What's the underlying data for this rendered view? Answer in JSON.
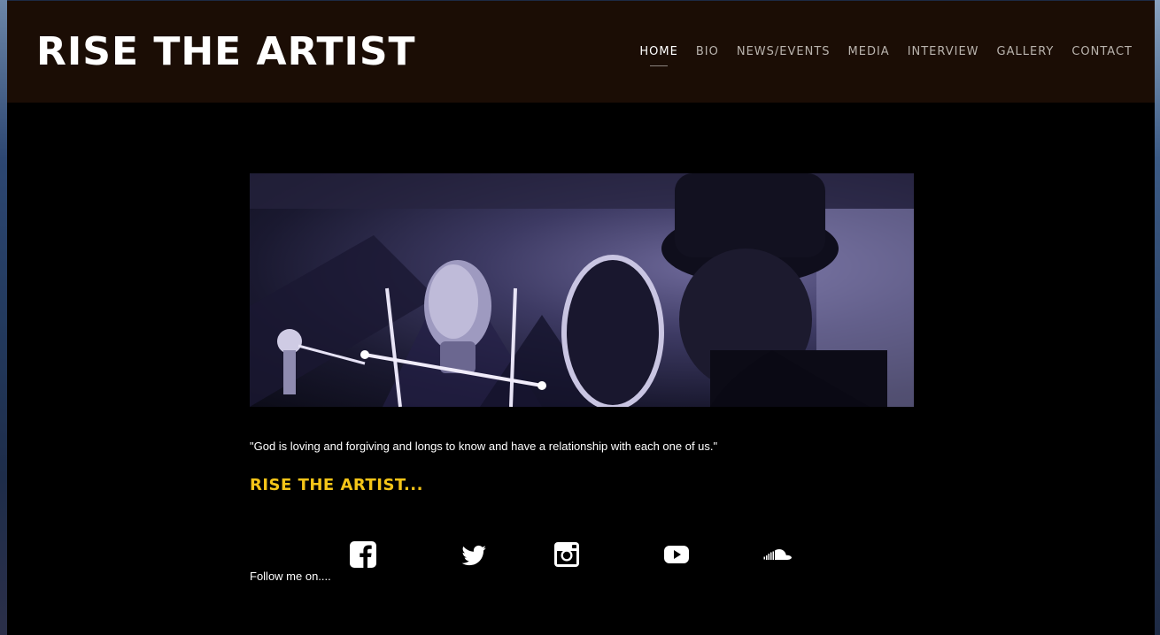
{
  "site": {
    "title": "RISE THE ARTIST",
    "nav": [
      {
        "label": "HOME"
      },
      {
        "label": "BIO"
      },
      {
        "label": "NEWS/EVENTS"
      },
      {
        "label": "MEDIA"
      },
      {
        "label": "INTERVIEW"
      },
      {
        "label": "GALLERY"
      },
      {
        "label": "CONTACT"
      }
    ],
    "active_nav": "HOME"
  },
  "main": {
    "quote": "\"God is loving and forgiving and longs to know and have a relationship with each one of us.\"",
    "tagline": "RISE THE ARTIST...",
    "follow_label": "Follow me on....",
    "social": [
      {
        "icon": "facebook-icon"
      },
      {
        "icon": "twitter-icon"
      },
      {
        "icon": "instagram-icon"
      },
      {
        "icon": "youtube-icon"
      },
      {
        "icon": "soundcloud-icon"
      }
    ]
  },
  "colors": {
    "header_bg": "#1b0d05",
    "page_bg": "#000000",
    "accent": "#f5c518",
    "nav_text": "#b9b3ad"
  }
}
